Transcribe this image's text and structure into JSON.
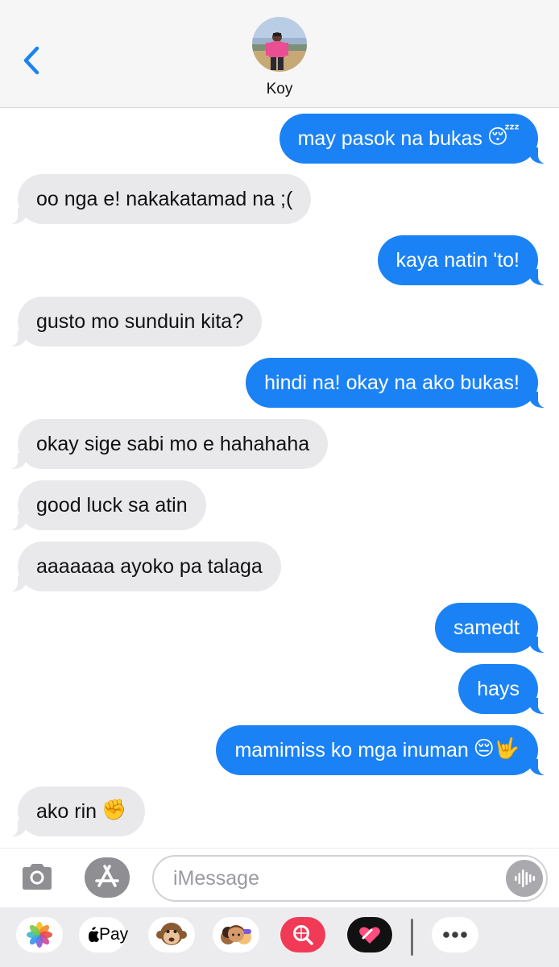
{
  "header": {
    "back_icon": "chevron-left-icon",
    "contact_name": "Koy",
    "accent_color": "#1b82f5"
  },
  "messages": [
    {
      "direction": "outgoing",
      "text": "may pasok na bukas",
      "emoji": "😴"
    },
    {
      "direction": "incoming",
      "text": "oo nga e! nakakatamad na ;(",
      "emoji": ""
    },
    {
      "direction": "outgoing",
      "text": "kaya natin 'to!",
      "emoji": ""
    },
    {
      "direction": "incoming",
      "text": "gusto mo sunduin kita?",
      "emoji": ""
    },
    {
      "direction": "outgoing",
      "text": "hindi na! okay na ako bukas!",
      "emoji": ""
    },
    {
      "direction": "incoming",
      "text": "okay sige sabi mo e hahahaha",
      "emoji": ""
    },
    {
      "direction": "incoming",
      "text": "good luck sa atin",
      "emoji": ""
    },
    {
      "direction": "incoming",
      "text": "aaaaaaa ayoko pa talaga",
      "emoji": ""
    },
    {
      "direction": "outgoing",
      "text": "samedt",
      "emoji": ""
    },
    {
      "direction": "outgoing",
      "text": "hays",
      "emoji": ""
    },
    {
      "direction": "outgoing",
      "text": "mamimiss ko mga inuman",
      "emoji": "😔🤟"
    },
    {
      "direction": "incoming",
      "text": "ako rin",
      "emoji": "✊"
    }
  ],
  "composer": {
    "camera_icon": "camera-icon",
    "apps_icon": "app-store-icon",
    "placeholder": "iMessage",
    "value": "",
    "audio_icon": "audio-waveform-icon"
  },
  "app_tray": {
    "items": [
      {
        "name": "photos-icon"
      },
      {
        "name": "apple-pay-icon",
        "label": "Pay"
      },
      {
        "name": "animoji-monkey-icon"
      },
      {
        "name": "memoji-stickers-icon"
      },
      {
        "name": "image-search-icon"
      },
      {
        "name": "digital-touch-icon"
      },
      {
        "name": "more-icon"
      }
    ]
  }
}
